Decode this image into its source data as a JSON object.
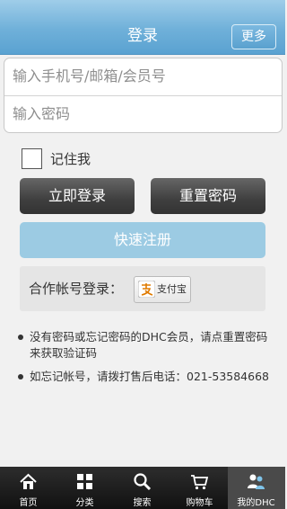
{
  "header": {
    "title": "登录",
    "more_label": "更多"
  },
  "form": {
    "account_placeholder": "输入手机号/邮箱/会员号",
    "password_placeholder": "输入密码",
    "remember_label": "记住我",
    "remember_checked": false
  },
  "buttons": {
    "login": "立即登录",
    "reset_password": "重置密码",
    "quick_register": "快速注册"
  },
  "partner": {
    "label": "合作帐号登录：",
    "alipay_label": "支付宝"
  },
  "notes": [
    "没有密码或忘记密码的DHC会员，请点重置密码来获取验证码",
    "如忘记帐号，请拨打售后电话：021-53584668"
  ],
  "tabs": [
    {
      "label": "首页",
      "icon": "home-icon"
    },
    {
      "label": "分类",
      "icon": "grid-icon"
    },
    {
      "label": "搜索",
      "icon": "search-icon"
    },
    {
      "label": "购物车",
      "icon": "cart-icon"
    },
    {
      "label": "我的DHC",
      "icon": "user-icon",
      "active": true
    }
  ],
  "colors": {
    "header": "#6fb0d9",
    "quick_register": "#9ccbe3",
    "tabbar": "#1e1e1e"
  }
}
